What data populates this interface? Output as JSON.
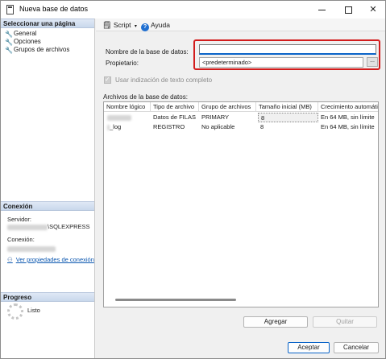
{
  "window": {
    "title": "Nueva base de datos"
  },
  "left_pane": {
    "select_page_header": "Seleccionar una página",
    "pages": [
      {
        "label": "General",
        "icon": "wrench-icon"
      },
      {
        "label": "Opciones",
        "icon": "wrench-icon"
      },
      {
        "label": "Grupos de archivos",
        "icon": "wrench-icon"
      }
    ],
    "connection_header": "Conexión",
    "server_label": "Servidor:",
    "server_value": "\\SQLEXPRESS",
    "connection_label": "Conexión:",
    "view_connection_link": "Ver propiedades de conexión",
    "progress_header": "Progreso",
    "progress_status": "Listo"
  },
  "toolbar": {
    "script_label": "Script",
    "help_label": "Ayuda"
  },
  "form": {
    "db_name_label": "Nombre de la base de datos:",
    "db_name_value": "",
    "owner_label": "Propietario:",
    "owner_value": "<predeterminado>",
    "browse_label": "...",
    "fulltext_label": "Usar indización de texto completo"
  },
  "files": {
    "section_label": "Archivos de la base de datos:",
    "columns": [
      "Nombre lógico",
      "Tipo de archivo",
      "Grupo de archivos",
      "Tamaño inicial (MB)",
      "Crecimiento automátic"
    ],
    "rows": [
      [
        "",
        "Datos de FILAS",
        "PRIMARY",
        "8",
        "En 64 MB, sin límite"
      ],
      [
        "_log",
        "REGISTRO",
        "No aplicable",
        "8",
        "En 64 MB, sin límite"
      ]
    ],
    "add_button": "Agregar",
    "remove_button": "Quitar"
  },
  "footer": {
    "ok_button": "Aceptar",
    "cancel_button": "Cancelar"
  },
  "colors": {
    "highlight_border": "#d21c1c",
    "focus_accent": "#0a64c8",
    "link": "#0b57b0"
  }
}
